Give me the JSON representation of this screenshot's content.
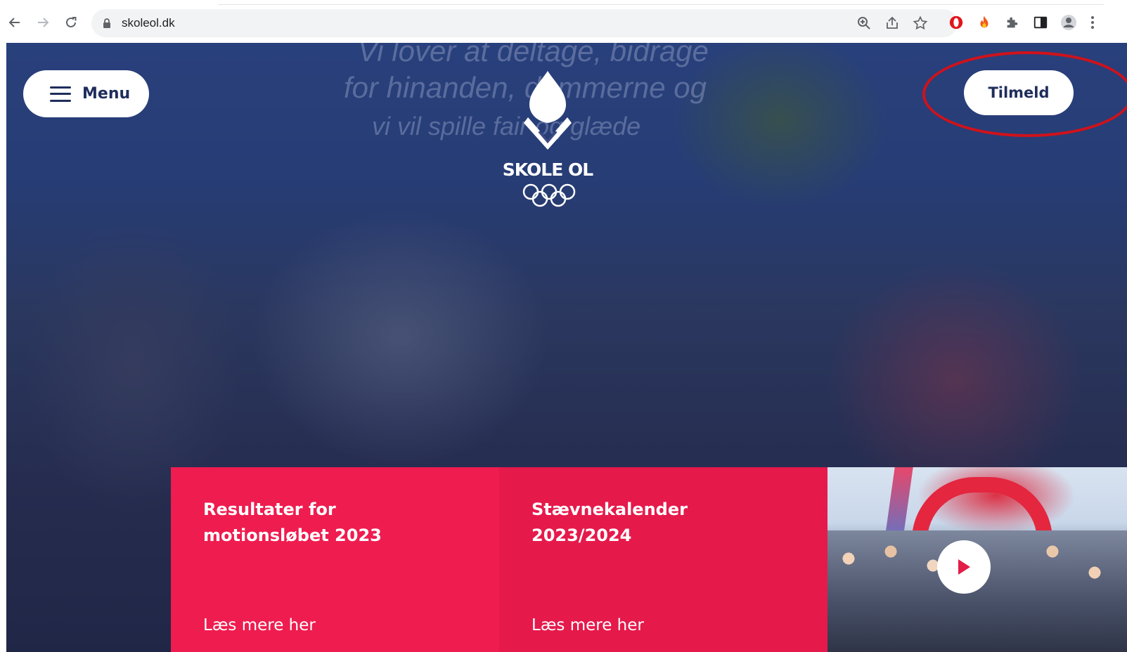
{
  "browser": {
    "url": "skoleol.dk"
  },
  "hero": {
    "banner_lines": [
      "Vi lover at deltage, bidrage",
      "for hinanden, dommerne og",
      "vi vil spille fair og glæde"
    ],
    "menu_label": "Menu",
    "signup_label": "Tilmeld",
    "logo_text": "SKOLE OL"
  },
  "cards": [
    {
      "title": "Resultater for motionsløbet 2023",
      "link": "Læs mere her"
    },
    {
      "title": "Stævnekalender 2023/2024",
      "link": "Læs mere her"
    }
  ],
  "colors": {
    "card_1": "#ef1c4f",
    "card_2": "#e6194b",
    "navy": "#1f2d5c",
    "highlight_ring": "#d0121b"
  },
  "icons": {
    "browser_toolbar": [
      "back-arrow-icon",
      "forward-arrow-icon",
      "reload-icon",
      "lock-icon",
      "zoom-icon",
      "share-icon",
      "star-icon",
      "opera-extension-icon",
      "flame-extension-icon",
      "puzzle-extension-icon",
      "side-panel-icon",
      "profile-icon",
      "kebab-menu-icon"
    ],
    "page": [
      "hamburger-icon",
      "olympic-rings-icon",
      "play-icon"
    ]
  }
}
